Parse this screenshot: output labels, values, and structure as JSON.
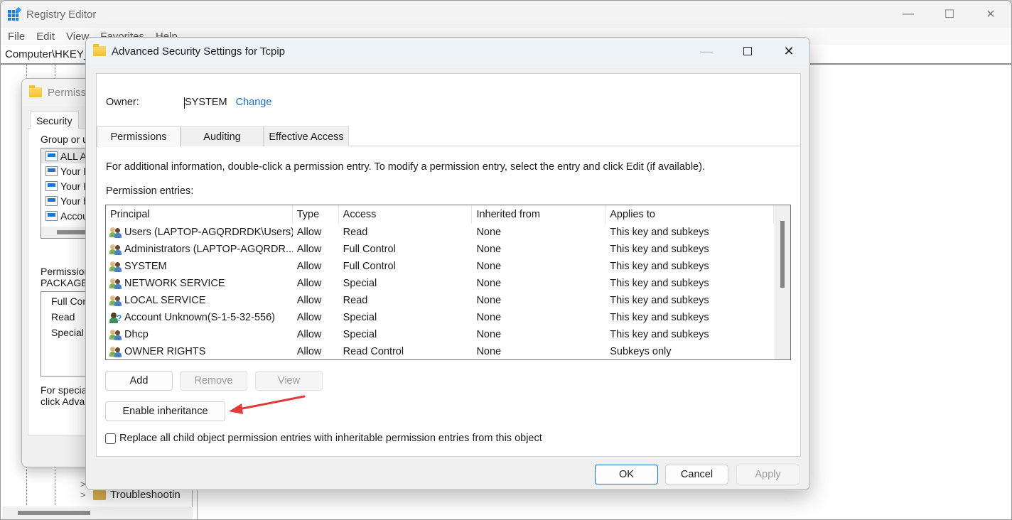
{
  "registry": {
    "title": "Registry Editor",
    "menu": [
      "File",
      "Edit",
      "View",
      "Favorites",
      "Help"
    ],
    "address": "Computer\\HKEY_",
    "tree_visible_item": "Troubleshootin",
    "controls": {
      "minimize": "—",
      "maximize": "☐",
      "close": "✕"
    }
  },
  "permissions_dialog": {
    "title": "Permissi",
    "tab": "Security",
    "group_label": "Group or us",
    "groups": [
      "ALL A",
      "Your I",
      "Your I",
      "Your h",
      "Accou"
    ],
    "permissions_label_line1": "Permission",
    "permissions_label_line2": "PACKAGE",
    "permissions": [
      "Full Con",
      "Read",
      "Special"
    ],
    "footer_line1": "For specia",
    "footer_line2": "click Adva"
  },
  "advanced": {
    "title": "Advanced Security Settings for Tcpip",
    "controls": {
      "minimize": "—",
      "close": "✕"
    },
    "owner_label": "Owner:",
    "owner_value": "SYSTEM",
    "owner_change": "Change",
    "tabs": [
      {
        "label": "Permissions",
        "active": true
      },
      {
        "label": "Auditing",
        "active": false
      },
      {
        "label": "Effective Access",
        "active": false
      }
    ],
    "info_text": "For additional information, double-click a permission entry. To modify a permission entry, select the entry and click Edit (if available).",
    "entries_label": "Permission entries:",
    "columns": [
      "Principal",
      "Type",
      "Access",
      "Inherited from",
      "Applies to"
    ],
    "entries": [
      {
        "icon": "users",
        "principal": "Users (LAPTOP-AGQRDRDK\\Users)",
        "type": "Allow",
        "access": "Read",
        "inherited": "None",
        "applies": "This key and subkeys"
      },
      {
        "icon": "users",
        "principal": "Administrators (LAPTOP-AGQRDR...",
        "type": "Allow",
        "access": "Full Control",
        "inherited": "None",
        "applies": "This key and subkeys"
      },
      {
        "icon": "users",
        "principal": "SYSTEM",
        "type": "Allow",
        "access": "Full Control",
        "inherited": "None",
        "applies": "This key and subkeys"
      },
      {
        "icon": "users",
        "principal": "NETWORK SERVICE",
        "type": "Allow",
        "access": "Special",
        "inherited": "None",
        "applies": "This key and subkeys"
      },
      {
        "icon": "users",
        "principal": "LOCAL SERVICE",
        "type": "Allow",
        "access": "Read",
        "inherited": "None",
        "applies": "This key and subkeys"
      },
      {
        "icon": "unknown",
        "principal": "Account Unknown(S-1-5-32-556)",
        "type": "Allow",
        "access": "Special",
        "inherited": "None",
        "applies": "This key and subkeys"
      },
      {
        "icon": "users",
        "principal": "Dhcp",
        "type": "Allow",
        "access": "Special",
        "inherited": "None",
        "applies": "This key and subkeys"
      },
      {
        "icon": "users",
        "principal": "OWNER RIGHTS",
        "type": "Allow",
        "access": "Read Control",
        "inherited": "None",
        "applies": "Subkeys only"
      }
    ],
    "buttons": {
      "add": "Add",
      "remove": "Remove",
      "view": "View",
      "enable_inheritance": "Enable inheritance",
      "ok": "OK",
      "cancel": "Cancel",
      "apply": "Apply"
    },
    "replace_checkbox": {
      "label": "Replace all child object permission entries with inheritable permission entries from this object",
      "checked": false
    },
    "annotation_arrow_color": "#e03a3a",
    "link_color": "#1a6fc7"
  }
}
